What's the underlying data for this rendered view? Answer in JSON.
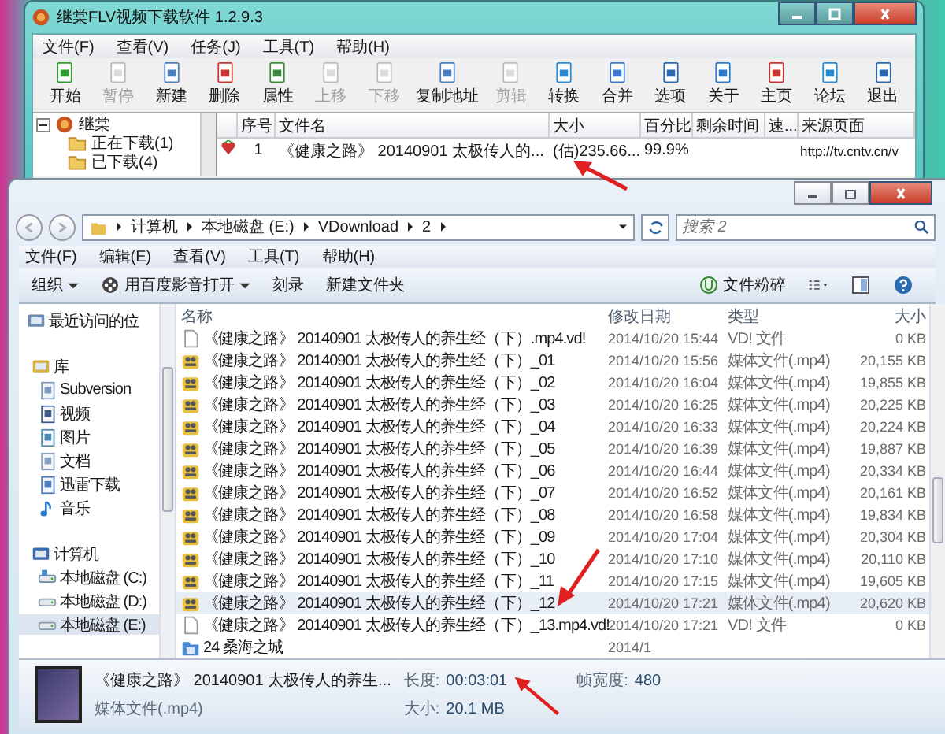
{
  "app_window": {
    "title": "继棠FLV视频下载软件 1.2.9.3",
    "menu": [
      "文件(F)",
      "查看(V)",
      "任务(J)",
      "工具(T)",
      "帮助(H)"
    ],
    "toolbar": [
      {
        "label": "开始",
        "disabled": false
      },
      {
        "label": "暂停",
        "disabled": true
      },
      {
        "label": "新建",
        "disabled": false
      },
      {
        "label": "删除",
        "disabled": false
      },
      {
        "label": "属性",
        "disabled": false
      },
      {
        "label": "上移",
        "disabled": true
      },
      {
        "label": "下移",
        "disabled": true
      },
      {
        "label": "复制地址",
        "disabled": false
      },
      {
        "label": "剪辑",
        "disabled": true
      },
      {
        "label": "转换",
        "disabled": false
      },
      {
        "label": "合并",
        "disabled": false
      },
      {
        "label": "选项",
        "disabled": false
      },
      {
        "label": "关于",
        "disabled": false
      },
      {
        "label": "主页",
        "disabled": false
      },
      {
        "label": "论坛",
        "disabled": false
      },
      {
        "label": "退出",
        "disabled": false
      }
    ],
    "tree": {
      "label": "继棠",
      "expanded": true,
      "children": [
        {
          "label": "正在下载(1)"
        },
        {
          "label": "已下载(4)"
        }
      ]
    },
    "table": {
      "columns": [
        "序号",
        "文件名",
        "大小",
        "百分比",
        "剩余时间",
        "速...",
        "来源页面"
      ],
      "rows": [
        {
          "index": "1",
          "file_name": "《健康之路》 20140901 太极传人的...",
          "size": "(估)235.66...",
          "percent": "99.9%",
          "source": "http://tv.cntv.cn/v"
        }
      ]
    }
  },
  "explorer": {
    "address": [
      "计算机",
      "本地磁盘 (E:)",
      "VDownload",
      "2"
    ],
    "search": {
      "placeholder": "搜索 2"
    },
    "menu": [
      "文件(F)",
      "编辑(E)",
      "查看(V)",
      "工具(T)",
      "帮助(H)"
    ],
    "commands": [
      {
        "label": "组织",
        "dropdown": true
      },
      {
        "label": "用百度影音打开",
        "dropdown": true
      },
      {
        "label": "刻录",
        "dropdown": false
      },
      {
        "label": "新建文件夹",
        "dropdown": false
      }
    ],
    "shred_button": "文件粉碎",
    "nav": [
      {
        "label": "最近访问的位",
        "kind": "recent",
        "selected": false
      },
      {
        "label": "库",
        "kind": "library",
        "selected": false,
        "children": [
          {
            "label": "Subversion",
            "kind": "svn",
            "selected": false
          },
          {
            "label": "视频",
            "kind": "video",
            "selected": false
          },
          {
            "label": "图片",
            "kind": "pictures",
            "selected": false
          },
          {
            "label": "文档",
            "kind": "documents",
            "selected": false
          },
          {
            "label": "迅雷下载",
            "kind": "download",
            "selected": false
          },
          {
            "label": "音乐",
            "kind": "music",
            "selected": false
          }
        ]
      },
      {
        "label": "计算机",
        "kind": "computer",
        "selected": false,
        "children": [
          {
            "label": "本地磁盘 (C:)",
            "kind": "system-drive",
            "selected": false
          },
          {
            "label": "本地磁盘 (D:)",
            "kind": "drive",
            "selected": false
          },
          {
            "label": "本地磁盘 (E:)",
            "kind": "drive",
            "selected": true
          }
        ]
      }
    ],
    "columns": [
      "名称",
      "修改日期",
      "类型",
      "大小"
    ],
    "files": [
      {
        "kind": "blank",
        "name": "《健康之路》 20140901 太极传人的养生经（下）.mp4.vd!",
        "date": "2014/10/20 15:44",
        "type": "VD! 文件",
        "size": "0 KB",
        "selected": false
      },
      {
        "kind": "media",
        "name": "《健康之路》 20140901 太极传人的养生经（下）_01",
        "date": "2014/10/20 15:56",
        "type": "媒体文件(.mp4)",
        "size": "20,155 KB",
        "selected": false
      },
      {
        "kind": "media",
        "name": "《健康之路》 20140901 太极传人的养生经（下）_02",
        "date": "2014/10/20 16:04",
        "type": "媒体文件(.mp4)",
        "size": "19,855 KB",
        "selected": false
      },
      {
        "kind": "media",
        "name": "《健康之路》 20140901 太极传人的养生经（下）_03",
        "date": "2014/10/20 16:25",
        "type": "媒体文件(.mp4)",
        "size": "20,225 KB",
        "selected": false
      },
      {
        "kind": "media",
        "name": "《健康之路》 20140901 太极传人的养生经（下）_04",
        "date": "2014/10/20 16:33",
        "type": "媒体文件(.mp4)",
        "size": "20,224 KB",
        "selected": false
      },
      {
        "kind": "media",
        "name": "《健康之路》 20140901 太极传人的养生经（下）_05",
        "date": "2014/10/20 16:39",
        "type": "媒体文件(.mp4)",
        "size": "19,887 KB",
        "selected": false
      },
      {
        "kind": "media",
        "name": "《健康之路》 20140901 太极传人的养生经（下）_06",
        "date": "2014/10/20 16:44",
        "type": "媒体文件(.mp4)",
        "size": "20,334 KB",
        "selected": false
      },
      {
        "kind": "media",
        "name": "《健康之路》 20140901 太极传人的养生经（下）_07",
        "date": "2014/10/20 16:52",
        "type": "媒体文件(.mp4)",
        "size": "20,161 KB",
        "selected": false
      },
      {
        "kind": "media",
        "name": "《健康之路》 20140901 太极传人的养生经（下）_08",
        "date": "2014/10/20 16:58",
        "type": "媒体文件(.mp4)",
        "size": "19,834 KB",
        "selected": false
      },
      {
        "kind": "media",
        "name": "《健康之路》 20140901 太极传人的养生经（下）_09",
        "date": "2014/10/20 17:04",
        "type": "媒体文件(.mp4)",
        "size": "20,304 KB",
        "selected": false
      },
      {
        "kind": "media",
        "name": "《健康之路》 20140901 太极传人的养生经（下）_10",
        "date": "2014/10/20 17:10",
        "type": "媒体文件(.mp4)",
        "size": "20,110 KB",
        "selected": false
      },
      {
        "kind": "media",
        "name": "《健康之路》 20140901 太极传人的养生经（下）_11",
        "date": "2014/10/20 17:15",
        "type": "媒体文件(.mp4)",
        "size": "19,605 KB",
        "selected": false
      },
      {
        "kind": "media",
        "name": "《健康之路》 20140901 太极传人的养生经（下）_12",
        "date": "2014/10/20 17:21",
        "type": "媒体文件(.mp4)",
        "size": "20,620 KB",
        "selected": true
      },
      {
        "kind": "blank",
        "name": "《健康之路》 20140901 太极传人的养生经（下）_13.mp4.vd!",
        "date": "2014/10/20 17:21",
        "type": "VD! 文件",
        "size": "0 KB",
        "selected": false
      },
      {
        "kind": "folder",
        "name": "24 桑海之城",
        "date": "2014/1",
        "selected": false
      }
    ],
    "details": {
      "name": "《健康之路》 20140901 太极传人的养生...",
      "type": "媒体文件(.mp4)",
      "fields": [
        {
          "label": "长度:",
          "value": "00:03:01"
        },
        {
          "label": "大小:",
          "value": "20.1 MB"
        },
        {
          "label": "帧宽度:",
          "value": "480"
        }
      ]
    }
  }
}
